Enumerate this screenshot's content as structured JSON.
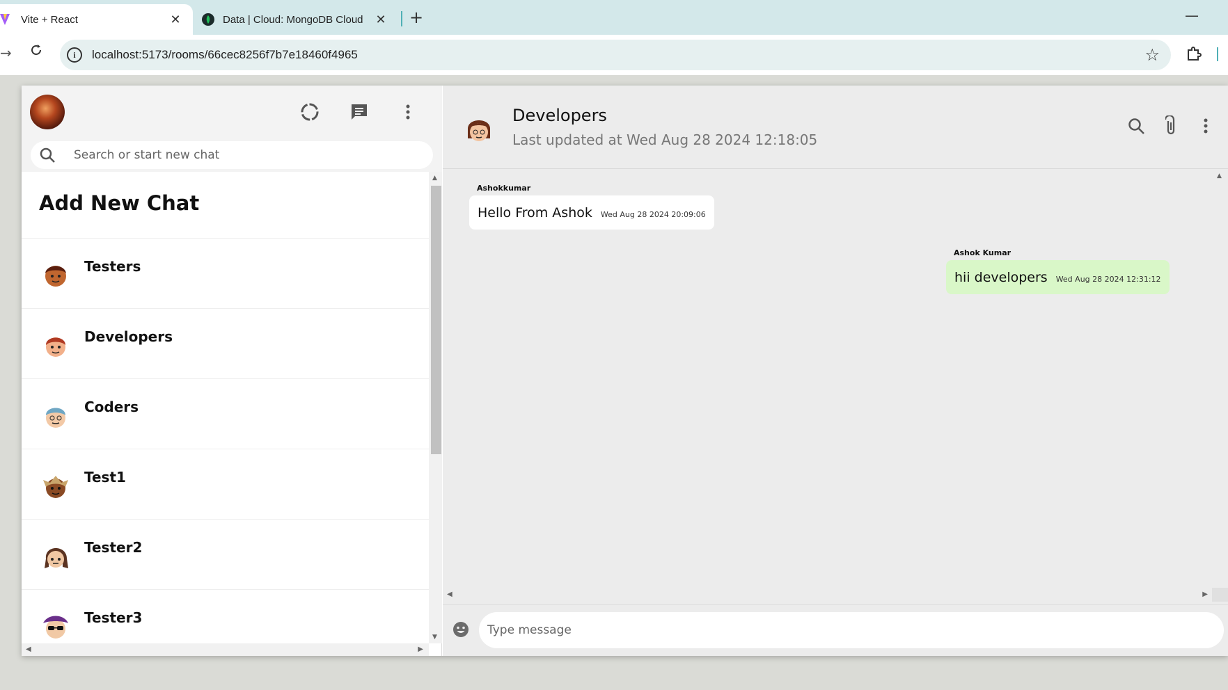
{
  "browser": {
    "tabs": [
      {
        "title": "Vite + React",
        "active": true
      },
      {
        "title": "Data | Cloud: MongoDB Cloud",
        "active": false
      }
    ],
    "url": "localhost:5173/rooms/66cec8256f7b7e18460f4965"
  },
  "sidebar": {
    "search_placeholder": "Search or start new chat",
    "add_new_chat": "Add New Chat",
    "rooms": [
      {
        "name": "Testers",
        "avatar_color": "#8a3b1c"
      },
      {
        "name": "Developers",
        "avatar_color": "#b03a23"
      },
      {
        "name": "Coders",
        "avatar_color": "#6fa7c4"
      },
      {
        "name": "Test1",
        "avatar_color": "#c9a56b"
      },
      {
        "name": "Tester2",
        "avatar_color": "#5b3321"
      },
      {
        "name": "Tester3",
        "avatar_color": "#6a2f8a"
      }
    ]
  },
  "chat": {
    "room_name": "Developers",
    "last_updated": "Last updated at Wed Aug 28 2024 12:18:05",
    "messages": [
      {
        "sender": "Ashokkumar",
        "text": "Hello From Ashok",
        "timestamp": "Wed Aug 28 2024 20:09:06",
        "outgoing": false
      },
      {
        "sender": "Ashok Kumar",
        "text": "hii developers",
        "timestamp": "Wed Aug 28 2024 12:31:12",
        "outgoing": true
      }
    ],
    "input_placeholder": "Type message"
  },
  "colors": {
    "outgoing_bubble": "#d9f7c8",
    "incoming_bubble": "#ffffff",
    "chat_background": "#ececec",
    "tab_strip": "#d3e8ea"
  }
}
